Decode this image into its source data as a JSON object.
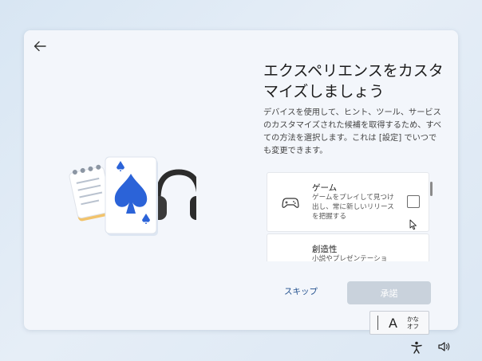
{
  "page": {
    "title": "エクスペリエンスをカスタマイズしましょう",
    "description": "デバイスを使用して、ヒント、ツール、サービスのカスタマイズされた候補を取得するため、すべての方法を選択します。これは [設定] でいつでも変更できます。"
  },
  "options": [
    {
      "title": "ゲーム",
      "description": "ゲームをプレイして見つけ出し、常に新しいリリースを把握する",
      "icon": "gamepad-icon",
      "checked": false
    },
    {
      "title": "創造性",
      "description": "小説やプレゼンテーショ"
    }
  ],
  "buttons": {
    "skip": "スキップ",
    "accept": "承諾"
  },
  "ime": {
    "mode_letter": "A",
    "kana_top": "かな",
    "kana_bottom": "オフ"
  },
  "icons": {
    "back": "back-arrow-icon",
    "illustration": "notepad-cards-headphones-illustration",
    "accessibility": "accessibility-icon",
    "volume": "volume-icon"
  },
  "colors": {
    "window_bg": "#f3f6fb",
    "accent_link": "#1f4e8c",
    "disabled_button": "#c9d2dc",
    "spade_blue": "#2b63d8"
  }
}
